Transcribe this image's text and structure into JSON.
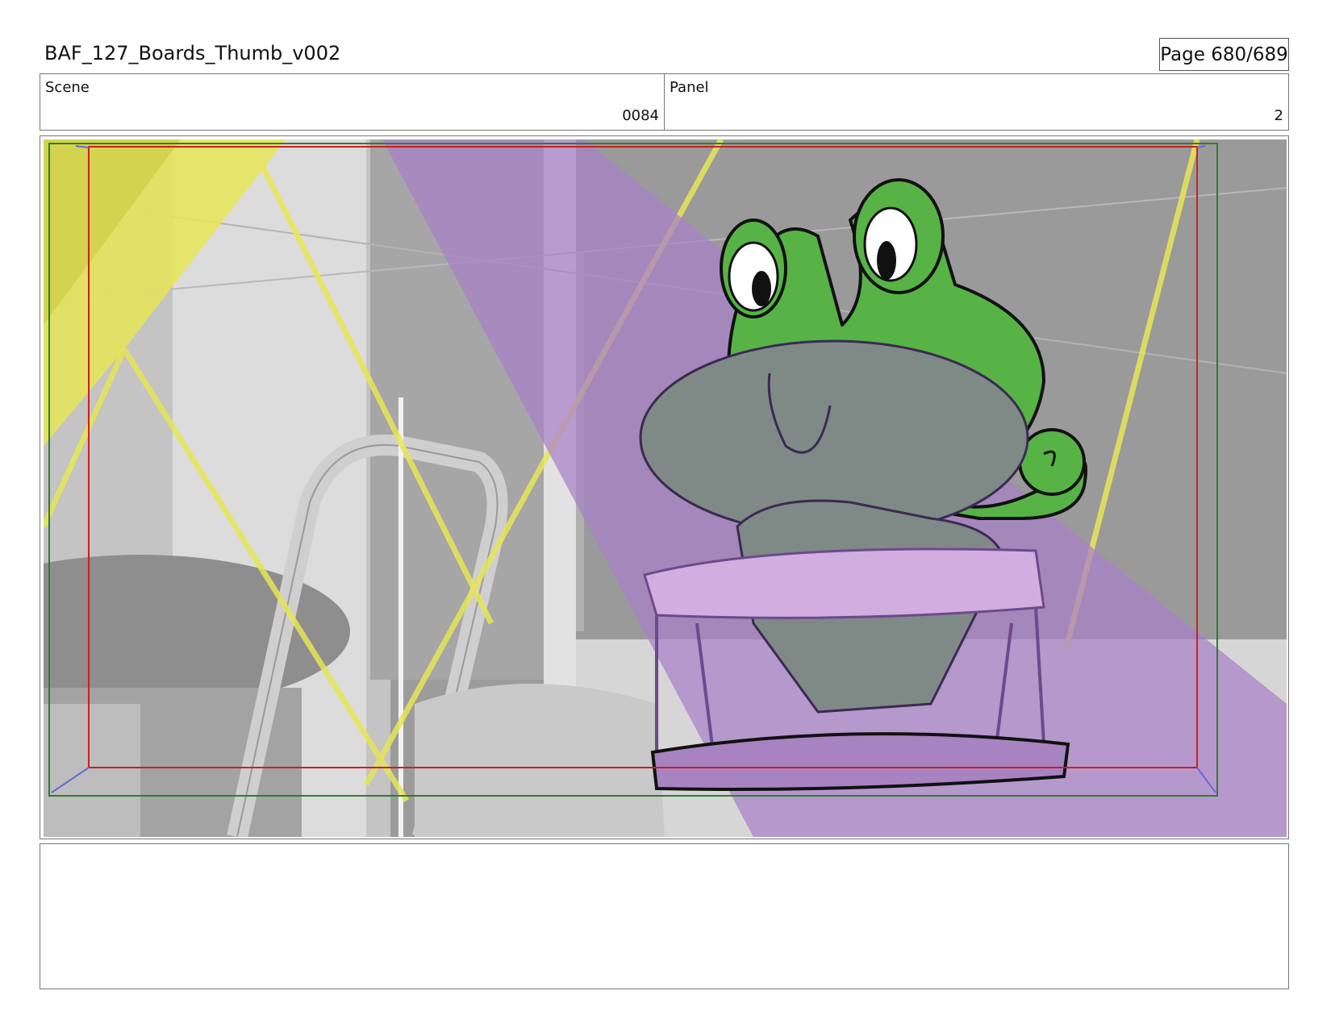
{
  "header": {
    "document_title": "BAF_127_Boards_Thumb_v002",
    "page_label": "Page 680/689"
  },
  "info": {
    "scene_label": "Scene",
    "scene_value": "0084",
    "panel_label": "Panel",
    "panel_value": "2"
  },
  "colors": {
    "safe_area_red": "#cc1f1f",
    "frame_green": "#2e7d32",
    "frog_green": "#57b346",
    "purple_light": "#a780c8",
    "yellow_light": "#e6e657"
  },
  "notes": {
    "text": ""
  }
}
